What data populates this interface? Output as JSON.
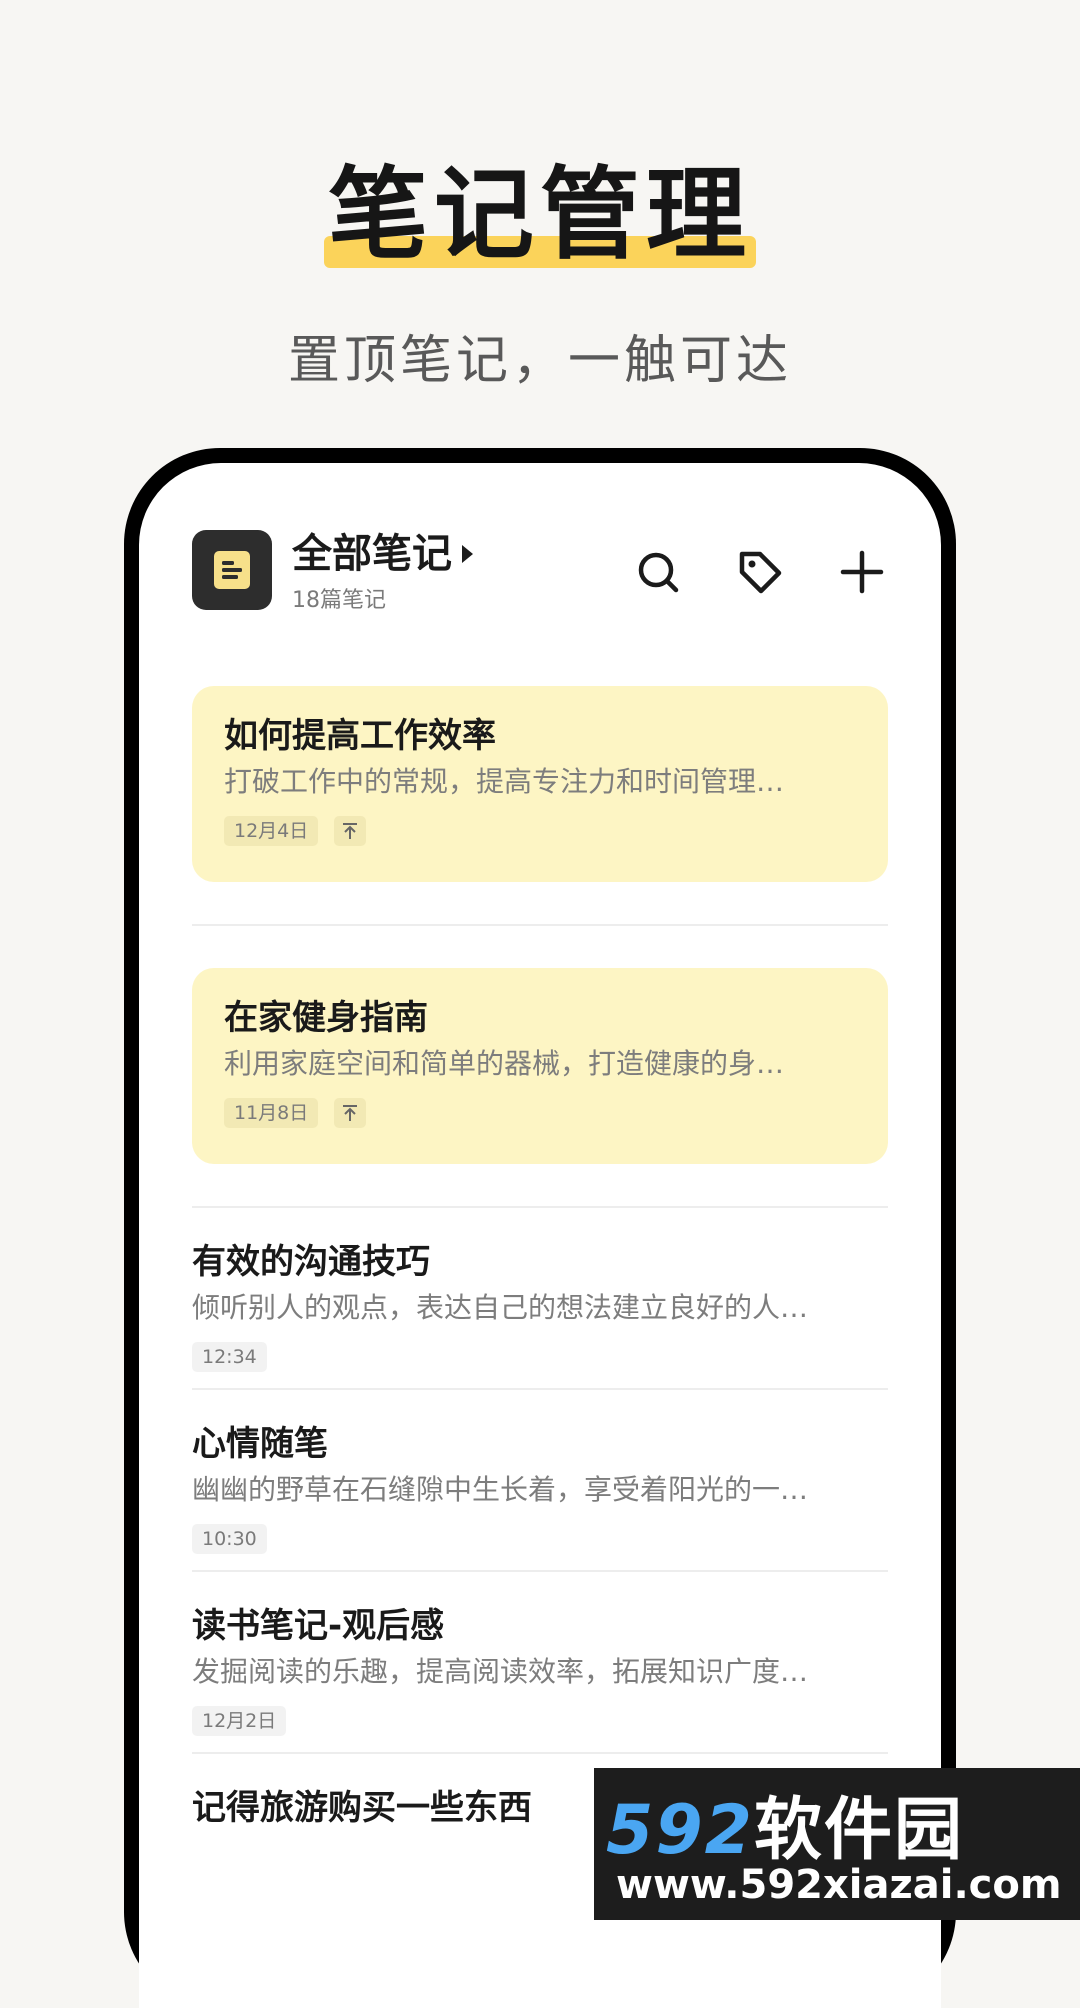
{
  "promo": {
    "title": "笔记管理",
    "subtitle": "置顶笔记，一触可达"
  },
  "header": {
    "title": "全部笔记",
    "count": "18篇笔记",
    "icons": [
      "notes-logo-icon",
      "caret-right-icon",
      "search-icon",
      "tag-icon",
      "plus-icon"
    ]
  },
  "notes": [
    {
      "title": "如何提高工作效率",
      "preview": "打破工作中的常规，提高专注力和时间管理…",
      "date": "12月4日",
      "pinned": true
    },
    {
      "title": "在家健身指南",
      "preview": "利用家庭空间和简单的器械，打造健康的身…",
      "date": "11月8日",
      "pinned": true
    },
    {
      "title": "有效的沟通技巧",
      "preview": "倾听别人的观点，表达自己的想法建立良好的人…",
      "date": "12:34",
      "pinned": false
    },
    {
      "title": "心情随笔",
      "preview": "幽幽的野草在石缝隙中生长着，享受着阳光的一…",
      "date": "10:30",
      "pinned": false
    },
    {
      "title": "读书笔记-观后感",
      "preview": "发掘阅读的乐趣，提高阅读效率，拓展知识广度…",
      "date": "12月2日",
      "pinned": false
    },
    {
      "title": "记得旅游购买一些东西",
      "preview": "",
      "date": "",
      "pinned": false
    }
  ],
  "watermark": {
    "brand_num": "592",
    "brand_cn": "软件园",
    "url": "www.592xiazai.com"
  },
  "colors": {
    "accent_yellow": "#fbd35a",
    "pinned_bg": "#fdf5c4",
    "page_bg": "#f7f6f3"
  }
}
